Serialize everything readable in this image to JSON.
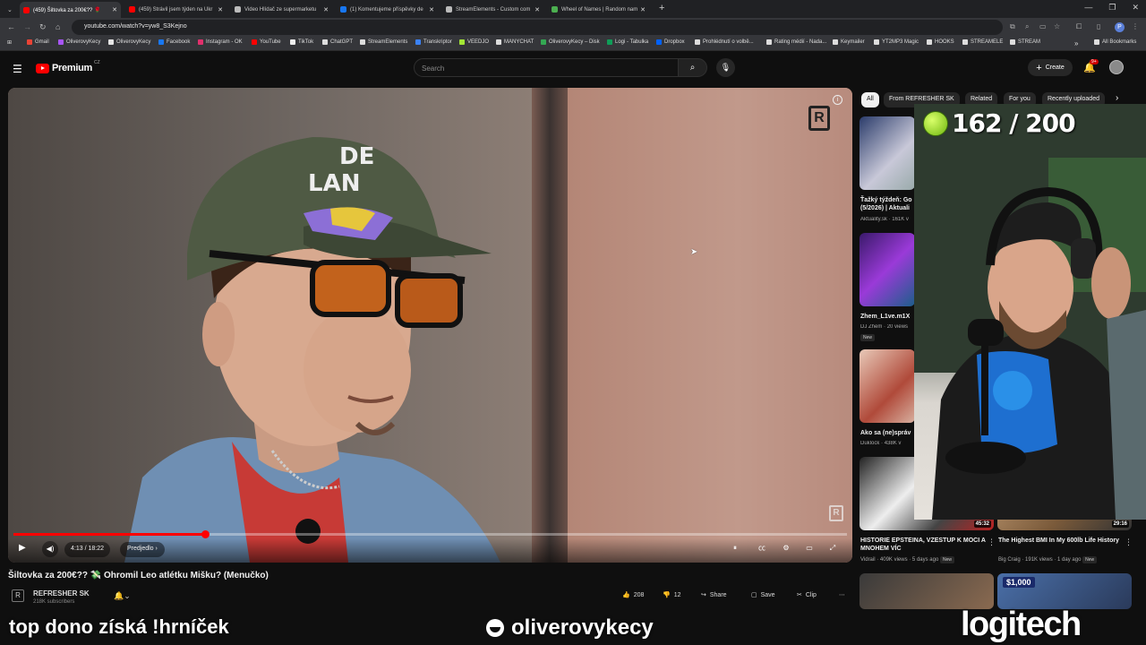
{
  "browser": {
    "tabs": [
      {
        "title": "(459) Šiltovka za 200€?? 🌹",
        "active": true,
        "favicon_color": "#ff0000"
      },
      {
        "title": "(459) Strávil jsem týden na Ukr",
        "active": false,
        "favicon_color": "#ff0000"
      },
      {
        "title": "Video Hlídač ze supermarketu",
        "active": false,
        "favicon_color": "#bbbbbb"
      },
      {
        "title": "(1) Komentujeme příspěvky de",
        "active": false,
        "favicon_color": "#1877f2"
      },
      {
        "title": "StreamElements - Custom com",
        "active": false,
        "favicon_color": "#bbbbbb"
      },
      {
        "title": "Wheel of Names | Random nam",
        "active": false,
        "favicon_color": "#4caf50"
      }
    ],
    "new_tab_label": "+",
    "url": "youtube.com/watch?v=yw8_S3Kejno",
    "profile_initial": "P",
    "bookmarks": [
      {
        "label": "Gmail",
        "color": "#ea4335"
      },
      {
        "label": "OliverovyKecy",
        "color": "#a855f7"
      },
      {
        "label": "OliverovyKecy",
        "color": "#e5e5e5"
      },
      {
        "label": "Facebook",
        "color": "#1877f2"
      },
      {
        "label": "Instagram - OK",
        "color": "#e1306c"
      },
      {
        "label": "YouTube",
        "color": "#ff0000"
      },
      {
        "label": "TikTok",
        "color": "#eeeeee"
      },
      {
        "label": "ChatGPT",
        "color": "#dddddd"
      },
      {
        "label": "StreamElements",
        "color": "#dddddd"
      },
      {
        "label": "Transkriptor",
        "color": "#3b82f6"
      },
      {
        "label": "VEEDJO",
        "color": "#a3e635"
      },
      {
        "label": "MANYCHAT",
        "color": "#dddddd"
      },
      {
        "label": "OliverovyKecy – Disk",
        "color": "#34a853"
      },
      {
        "label": "Logi - Tabulka",
        "color": "#0f9d58"
      },
      {
        "label": "Dropbox",
        "color": "#0061ff"
      },
      {
        "label": "Prohlédnutí o volbě...",
        "color": "#dddddd"
      },
      {
        "label": "Rating médií - Nada...",
        "color": "#dddddd"
      },
      {
        "label": "Keymailer",
        "color": "#dddddd"
      },
      {
        "label": "YT2MP3 Magic",
        "color": "#dddddd"
      },
      {
        "label": "HOOKS",
        "color": "#dddddd"
      },
      {
        "label": "STREAMELE",
        "color": "#dddddd"
      },
      {
        "label": "STREAM",
        "color": "#dddddd"
      }
    ],
    "all_bookmarks_label": "All Bookmarks"
  },
  "youtube": {
    "logo_text": "Premium",
    "logo_country": "CZ",
    "search_placeholder": "Search",
    "create_label": "Create",
    "notification_count": "9+",
    "player": {
      "current_time": "4:13",
      "duration": "18:22",
      "time_display": "4:13 / 18:22",
      "progress_fraction": 0.23,
      "chapter_label": "Predjedlo",
      "watermark_letter": "R"
    },
    "video_title": "Šiltovka za 200€?? 💸 Ohromil Leo atlétku Mišku? (Menučko)",
    "channel": {
      "name": "REFRESHER SK",
      "subscribers": "218K subscribers",
      "avatar_letter": "R"
    },
    "actions": {
      "likes": "208",
      "dislikes": "12",
      "share": "Share",
      "save": "Save",
      "clip": "Clip"
    },
    "chips": [
      "All",
      "From REFRESHER SK",
      "Related",
      "For you",
      "Recently uploaded"
    ],
    "recommendations": [
      {
        "title": "Ťažký týždeň: Go (5/2026) | Aktuali",
        "channel": "Aktuality.sk",
        "meta": "161K v",
        "new": false,
        "duration": ""
      },
      {
        "title": "Zhem_L1ve.m1X",
        "channel": "DJ Zhem",
        "meta": "20 views",
        "new": true,
        "duration": ""
      },
      {
        "title": "Ako sa (ne)správ",
        "channel": "Duklock",
        "meta": "438K v",
        "new": false,
        "duration": ""
      },
      {
        "title": "HISTORIE EPSTEINA, VZESTUP K MOCI A MNOHEM VÍC",
        "channel": "Vidrail",
        "meta": "409K views · 5 days ago",
        "new": true,
        "duration": "45:32"
      },
      {
        "title": "The Highest BMI In My 600lb Life History",
        "channel": "Big Craig",
        "meta": "191K views · 1 day ago",
        "new": true,
        "duration": "29:16"
      },
      {
        "title": "",
        "channel": "",
        "meta": "",
        "new": false,
        "duration": "",
        "badge": "$1,000"
      }
    ]
  },
  "webcam": {
    "goal_text": "162 / 200"
  },
  "stream_overlay": {
    "left_text": "top dono získá !hrníček",
    "handle": "oliverovykecy",
    "sponsor": "logitech"
  }
}
